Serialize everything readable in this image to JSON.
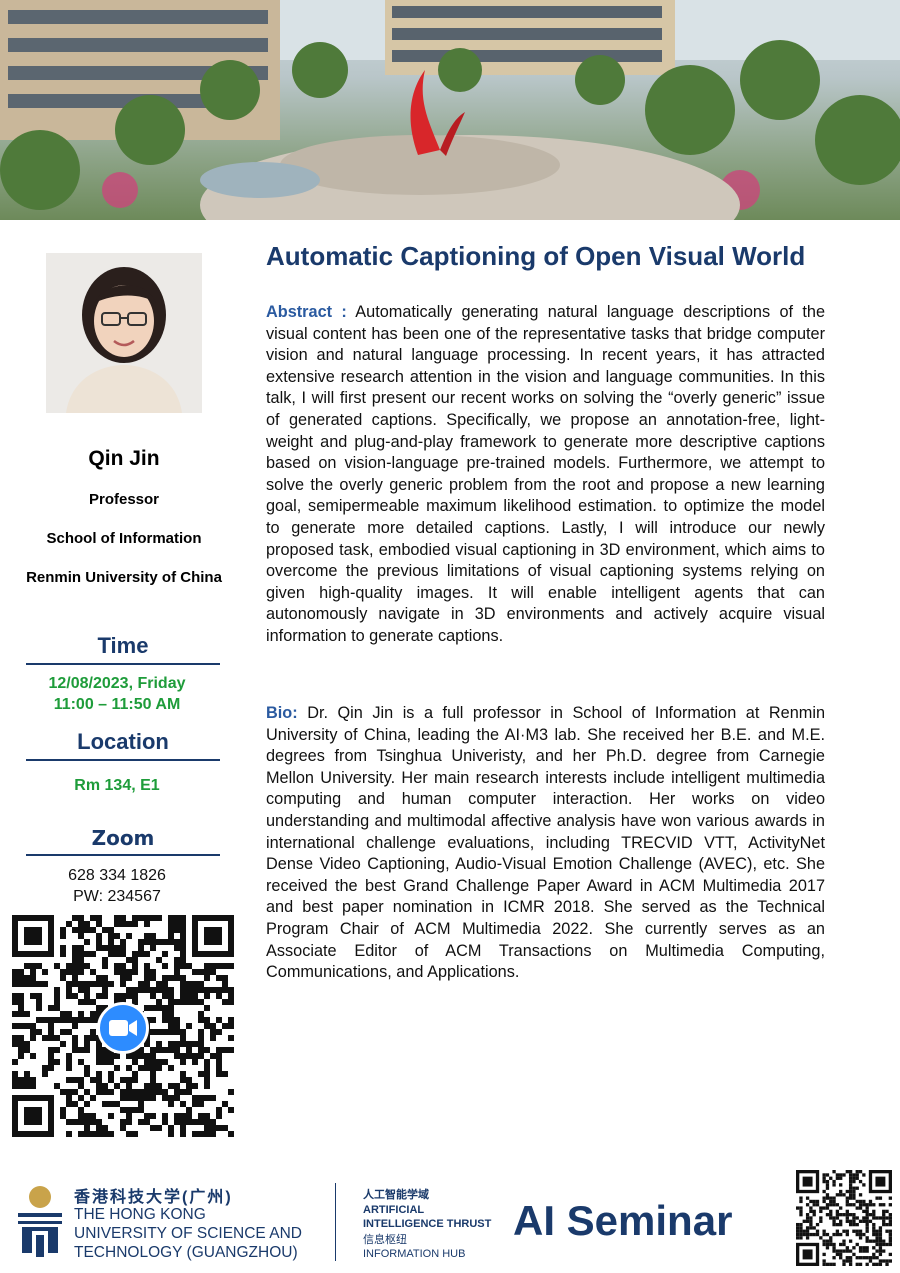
{
  "speaker": {
    "name": "Qin Jin",
    "title": "Professor",
    "department": "School of Information",
    "university": "Renmin University of China"
  },
  "time": {
    "heading": "Time",
    "date": "12/08/2023, Friday",
    "hours": "11:00 – 11:50 AM"
  },
  "location": {
    "heading": "Location",
    "room": "Rm 134, E1"
  },
  "zoom": {
    "heading": "Zoom",
    "meeting_id": "628 334 1826",
    "password": "PW: 234567"
  },
  "talk": {
    "title": "Automatic Captioning of Open Visual World",
    "abstract_label": "Abstract :",
    "abstract": "Automatically generating natural language descriptions of the visual content has been one of the representative tasks that bridge computer vision and natural language processing. In recent years, it has attracted extensive research attention in the vision and language communities. In this talk, I will first present our recent works on solving the “overly generic” issue of generated captions. Specifically, we propose an annotation-free, light-weight and plug-and-play framework to generate more descriptive captions based on vision-language pre-trained models. Furthermore, we attempt to solve the overly generic problem from the root and propose a new learning goal, semipermeable maximum likelihood estimation. to optimize the model to generate more detailed captions. Lastly, I will introduce our newly proposed task, embodied visual captioning in 3D environment, which aims to overcome the previous limitations of visual captioning systems relying on given high-quality images. It will enable intelligent agents that can autonomously navigate in 3D environments and actively acquire visual information to generate captions.",
    "bio_label": "Bio:",
    "bio": "Dr. Qin Jin is a full professor in School of Information at Renmin University of China, leading the AI·M3 lab. She received her B.E. and M.E. degrees from Tsinghua Univeristy, and her Ph.D. degree from Carnegie Mellon University. Her main research interests include intelligent multimedia computing and human computer interaction. Her works on video understanding and multimodal affective analysis have won various awards in international challenge evaluations, including TRECVID VTT, ActivityNet Dense Video Captioning, Audio-Visual Emotion Challenge (AVEC), etc. She received the best Grand Challenge Paper Award in ACM Multimedia 2017 and best paper nomination in ICMR 2018. She served as the Technical Program Chair of ACM Multimedia 2022.  She currently serves as an Associate Editor of ACM Transactions on Multimedia Computing, Communications, and Applications."
  },
  "footer": {
    "university_cn": "香港科技大学(广州)",
    "university_en_1": "THE HONG KONG",
    "university_en_2": "UNIVERSITY OF SCIENCE AND",
    "university_en_3": "TECHNOLOGY (GUANGZHOU)",
    "thrust_cn": "人工智能学域",
    "thrust_en_1": "ARTIFICIAL",
    "thrust_en_2": "INTELLIGENCE THRUST",
    "hub_cn": "信息枢纽",
    "hub_en": "INFORMATION HUB",
    "event_name": "AI Seminar"
  },
  "colors": {
    "navy": "#1a3a6b",
    "green": "#1e9c3a",
    "label_blue": "#2a5aa0",
    "zoom_blue": "#2d8cff"
  },
  "icons": {
    "zoom": "zoom-camera-icon",
    "uni_logo": "hkust-gz-logo"
  }
}
